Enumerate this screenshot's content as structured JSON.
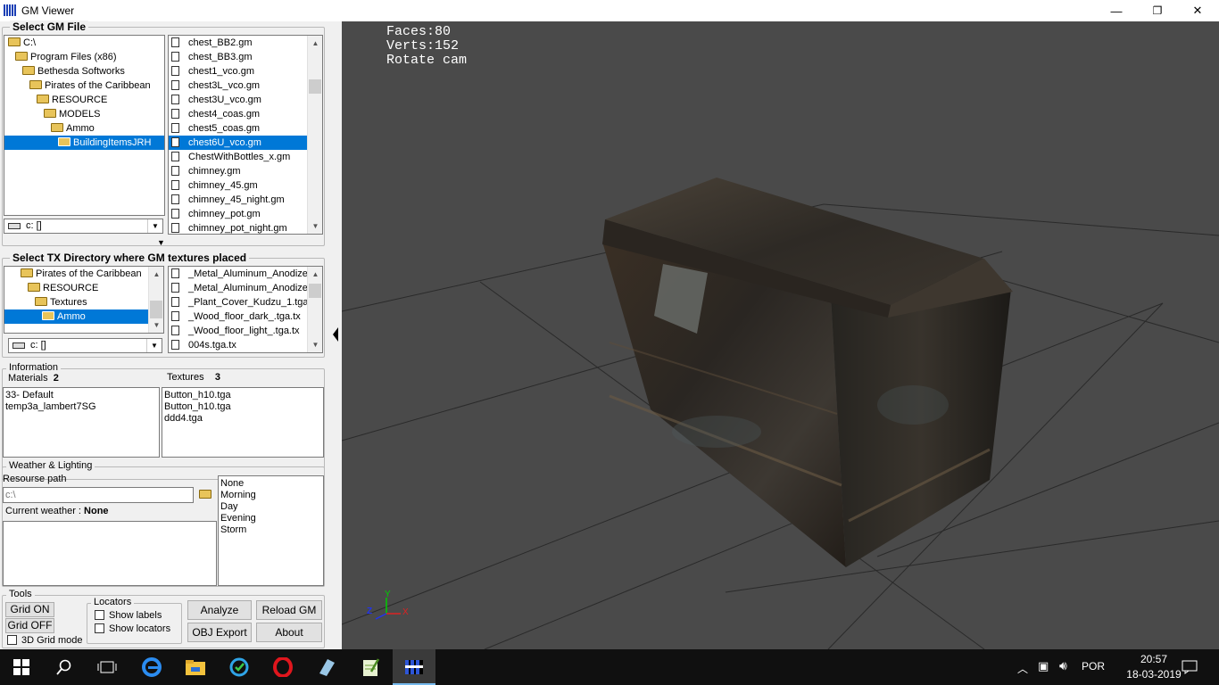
{
  "window": {
    "title": "GM Viewer",
    "minimize": "—",
    "restore": "❐",
    "close": "✕"
  },
  "gm_file": {
    "title": "Select GM File",
    "tree": [
      {
        "label": "C:\\",
        "indent": 0
      },
      {
        "label": "Program Files (x86)",
        "indent": 1
      },
      {
        "label": "Bethesda Softworks",
        "indent": 2
      },
      {
        "label": "Pirates of the Caribbean",
        "indent": 3
      },
      {
        "label": "RESOURCE",
        "indent": 4
      },
      {
        "label": "MODELS",
        "indent": 5
      },
      {
        "label": "Ammo",
        "indent": 6
      },
      {
        "label": "BuildingItemsJRH",
        "indent": 7,
        "selected": true
      }
    ],
    "files": [
      "chest_BB2.gm",
      "chest_BB3.gm",
      "chest1_vco.gm",
      "chest3L_vco.gm",
      "chest3U_vco.gm",
      "chest4_coas.gm",
      "chest5_coas.gm",
      "chest6U_vco.gm",
      "ChestWithBottles_x.gm",
      "chimney.gm",
      "chimney_45.gm",
      "chimney_45_night.gm",
      "chimney_pot.gm",
      "chimney_pot_night.gm"
    ],
    "selected_file": 7,
    "drive": "c: []"
  },
  "tx_dir": {
    "title": "Select TX Directory where GM textures placed",
    "tree": [
      {
        "label": "Pirates of the Caribbean",
        "indent": 0
      },
      {
        "label": "RESOURCE",
        "indent": 1
      },
      {
        "label": "Textures",
        "indent": 2
      },
      {
        "label": "Ammo",
        "indent": 3,
        "selected": true
      }
    ],
    "files": [
      "_Metal_Aluminum_Anodized",
      "_Metal_Aluminum_Anodized",
      "_Plant_Cover_Kudzu_1.tga.",
      "_Wood_floor_dark_.tga.tx",
      "_Wood_floor_light_.tga.tx",
      "004s.tga.tx"
    ],
    "drive": "c: []"
  },
  "info": {
    "title": "Information",
    "materials_label": "Materials",
    "materials_count": "2",
    "textures_label": "Textures",
    "textures_count": "3",
    "materials": [
      "33- Default",
      "temp3a_lambert7SG"
    ],
    "textures": [
      "Button_h10.tga",
      "Button_h10.tga",
      "ddd4.tga"
    ]
  },
  "weather": {
    "title": "Weather & Lighting",
    "resource_label": "Resourse path",
    "resource_value": "c:\\",
    "current_label": "Current weather :",
    "current_value": "None",
    "options": [
      "None",
      "Morning",
      "Day",
      "Evening",
      "Storm"
    ]
  },
  "tools": {
    "title": "Tools",
    "grid_on": "Grid ON",
    "grid_off": "Grid OFF",
    "grid3d": "3D Grid mode",
    "locators_title": "Locators",
    "show_labels": "Show labels",
    "show_locators": "Show locators",
    "analyze": "Analyze",
    "reload": "Reload GM",
    "obj_export": "OBJ Export",
    "about": "About"
  },
  "viewport": {
    "faces": "Faces:80",
    "verts": "Verts:152",
    "mode": "Rotate cam",
    "axis_y": "Y",
    "axis_z": "Z",
    "axis_x": "X"
  },
  "taskbar": {
    "lang": "POR",
    "time": "20:57",
    "date": "18-03-2019"
  }
}
